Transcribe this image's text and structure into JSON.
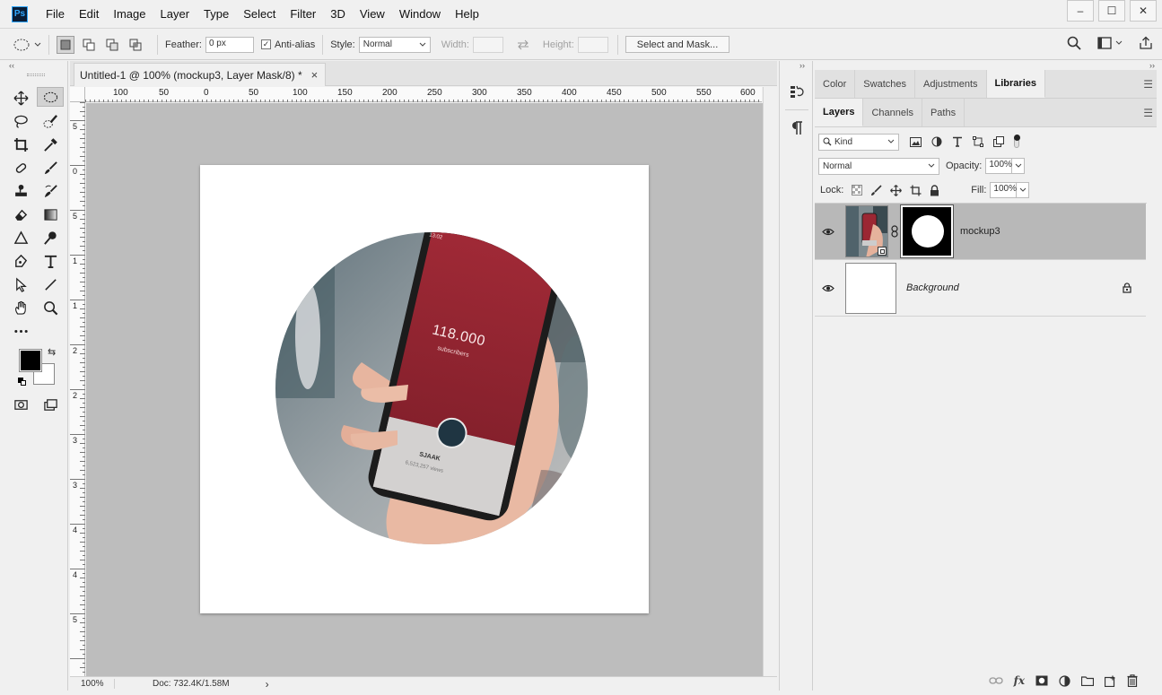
{
  "app": {
    "logo_text": "Ps",
    "menu": [
      "File",
      "Edit",
      "Image",
      "Layer",
      "Type",
      "Select",
      "Filter",
      "3D",
      "View",
      "Window",
      "Help"
    ],
    "window_controls": {
      "minimize": "–",
      "maximize": "☐",
      "close": "✕"
    }
  },
  "options_bar": {
    "feather_label": "Feather:",
    "feather_value": "0 px",
    "antialias_label": "Anti-alias",
    "antialias_checked": true,
    "style_label": "Style:",
    "style_value": "Normal",
    "width_label": "Width:",
    "height_label": "Height:",
    "select_mask_label": "Select and Mask..."
  },
  "document": {
    "tab_title": "Untitled-1 @ 100% (mockup3, Layer Mask/8) *",
    "close_glyph": "×",
    "ruler_h_labels": [
      "100",
      "50",
      "0",
      "50",
      "100",
      "150",
      "200",
      "250",
      "300",
      "350",
      "400",
      "450",
      "500",
      "550",
      "600"
    ],
    "ruler_v_labels": [
      "5",
      "0",
      "5",
      "1",
      "1",
      "2",
      "2",
      "3",
      "3",
      "4",
      "4",
      "5"
    ],
    "phone_time": "13:02",
    "phone_count": "118.000",
    "phone_sub": "subscribers",
    "phone_name": "SJAAK",
    "phone_views": "6,523,257 views"
  },
  "status": {
    "zoom": "100%",
    "doc_info": "Doc: 732.4K/1.58M",
    "arrow": "›"
  },
  "panels": {
    "top_tabs": [
      "Color",
      "Swatches",
      "Adjustments",
      "Libraries"
    ],
    "top_active": "Libraries",
    "layer_tabs": [
      "Layers",
      "Channels",
      "Paths"
    ],
    "layer_active": "Layers",
    "kind_label": "Kind",
    "blend_mode": "Normal",
    "opacity_label": "Opacity:",
    "opacity_value": "100%",
    "lock_label": "Lock:",
    "fill_label": "Fill:",
    "fill_value": "100%"
  },
  "layers": [
    {
      "name": "mockup3",
      "visible": true,
      "selected": true,
      "has_mask": true,
      "locked": false
    },
    {
      "name": "Background",
      "visible": true,
      "selected": false,
      "has_mask": false,
      "locked": true
    }
  ],
  "colors": {
    "accent": "#31a8ff",
    "canvas_bg": "#bdbdbd",
    "selected_layer": "#b8b8b8",
    "phone_screen": "#8f2330"
  }
}
